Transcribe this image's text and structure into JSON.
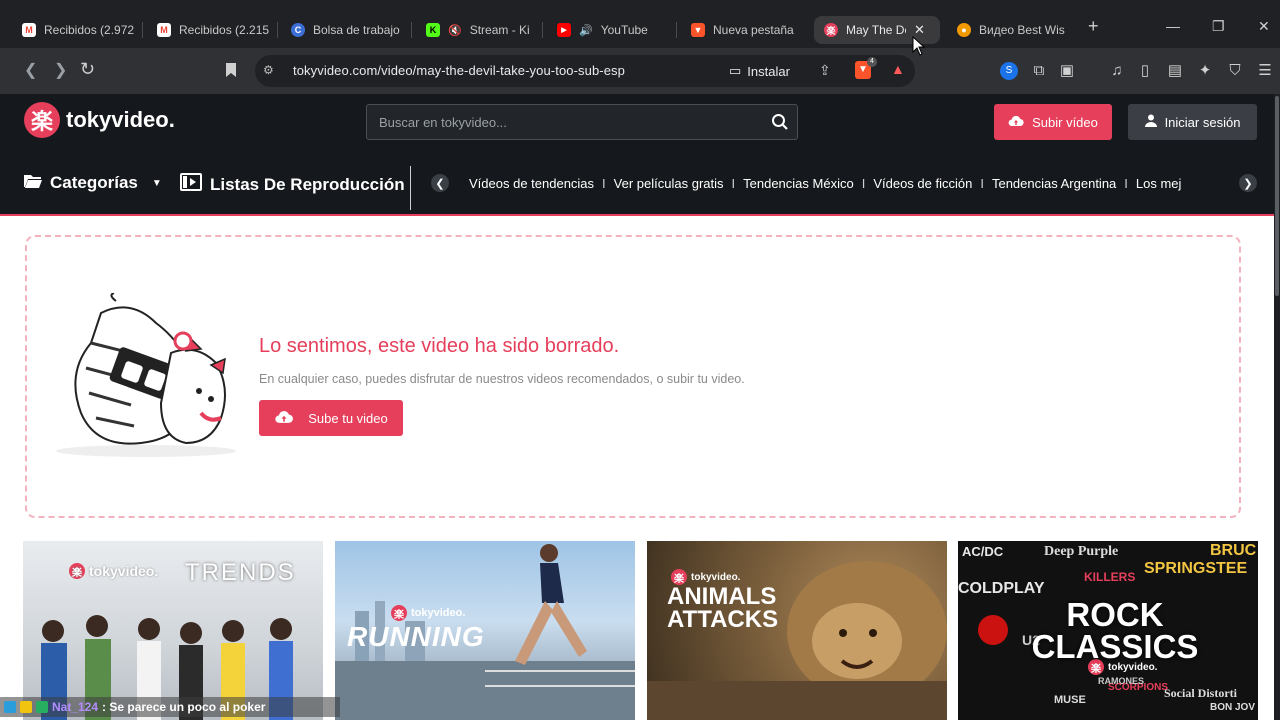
{
  "browser": {
    "tabs": [
      {
        "title": "Recibidos (2.972",
        "favicon": "gmail-icon",
        "color": "#ea4335"
      },
      {
        "title": "Recibidos (2.215",
        "favicon": "gmail-icon",
        "color": "#ea4335"
      },
      {
        "title": "Bolsa de trabajo",
        "favicon": "bolsa-icon",
        "color": "#3b6fd4"
      },
      {
        "title": "Stream - Kic",
        "favicon": "kick-icon",
        "color": "#53fc18"
      },
      {
        "title": "YouTube",
        "favicon": "youtube-icon",
        "color": "#ff0000"
      },
      {
        "title": "Nueva pestaña",
        "favicon": "brave-icon",
        "color": "#fb542b"
      },
      {
        "title": "May The De",
        "favicon": "tokyvideo-icon",
        "color": "#e63f5b"
      },
      {
        "title": "Видео Best Wis",
        "favicon": "site-icon",
        "color": "#f29900"
      }
    ],
    "url": "tokyvideo.com/video/may-the-devil-take-you-too-sub-esp",
    "install_label": "Instalar",
    "brave_badge": "4"
  },
  "site": {
    "logo_text": "tokyvideo.",
    "logo_mark": "楽",
    "search_placeholder": "Buscar en tokyvideo...",
    "upload_label": "Subir vídeo",
    "login_label": "Iniciar sesión",
    "categories_label": "Categorías",
    "playlists_label": "Listas De Reproducción",
    "trends": [
      "Vídeos de tendencias",
      "Ver películas gratis",
      "Tendencias México",
      "Vídeos de ficción",
      "Tendencias Argentina",
      "Los mej"
    ]
  },
  "notice": {
    "title": "Lo sentimos, este video ha sido borrado.",
    "subtitle": "En cualquier caso, puedes disfrutar de nuestros videos recomendados, o subir tu video.",
    "button_label": "Sube tu video"
  },
  "cards": [
    {
      "brand": "tokyvideo.",
      "headline": "TRENDS"
    },
    {
      "brand": "tokyvideo.",
      "headline": "RUNNING"
    },
    {
      "brand": "tokyvideo.",
      "headline": "ANIMALS ATTACKS"
    },
    {
      "brand": "tokyvideo.",
      "headline": "ROCK CLASSICS",
      "bands": [
        "AC/DC",
        "Deep Purple",
        "BRUC",
        "SPRINGSTEE",
        "KILLERS",
        "COLDPLAY",
        "U2",
        "SCORPIONS",
        "Social Distorti",
        "MUSE",
        "RAMONES",
        "BON JOV"
      ]
    }
  ],
  "chat": {
    "user": "Nat_124",
    "message": ": Se parece un poco al poker"
  },
  "colors": {
    "accent": "#e63f5b",
    "header_bg": "#15181c"
  }
}
